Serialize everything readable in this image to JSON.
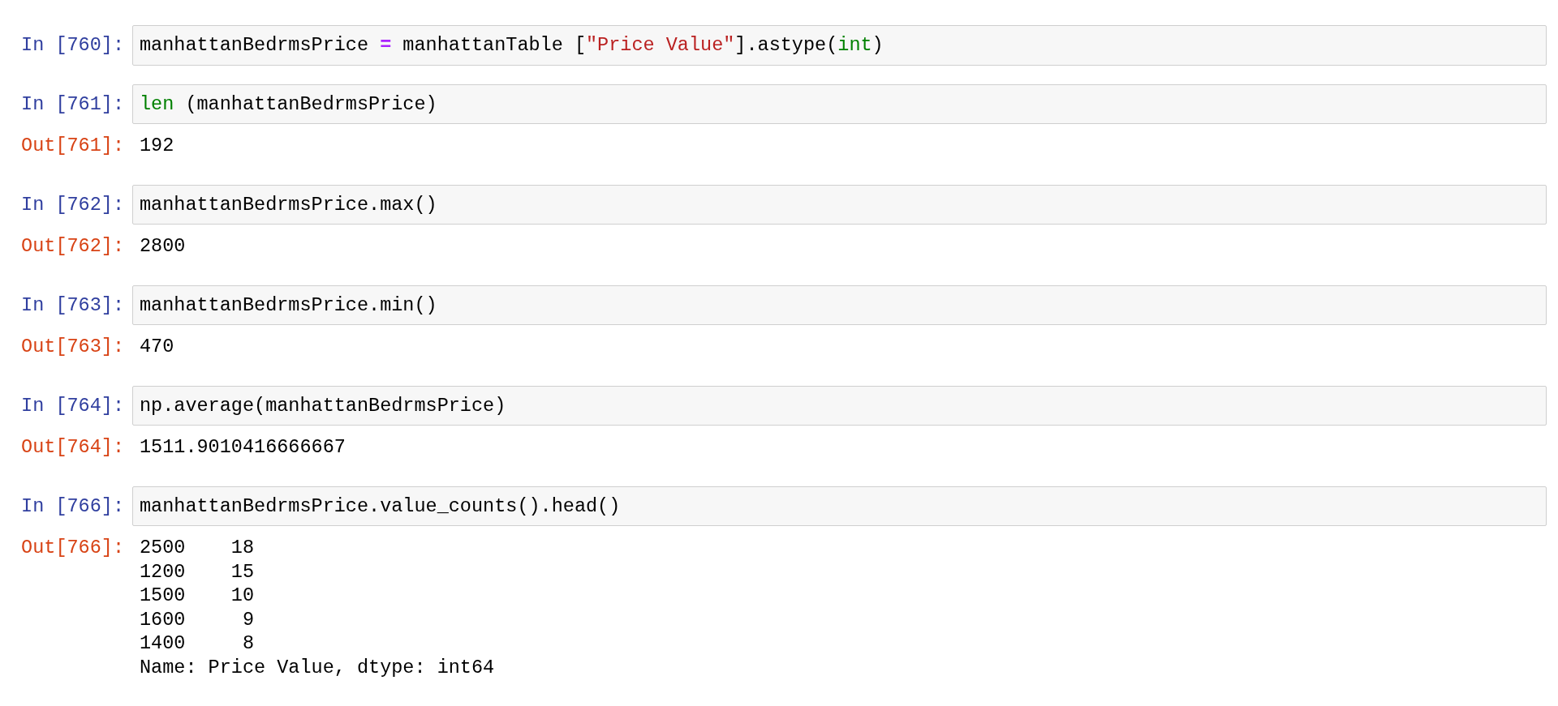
{
  "cells": [
    {
      "in_prompt": "In [760]:",
      "code": [
        {
          "kind": "plain",
          "text": "manhattanBedrmsPrice "
        },
        {
          "kind": "operator",
          "text": "="
        },
        {
          "kind": "plain",
          "text": " manhattanTable ["
        },
        {
          "kind": "string",
          "text": "\"Price Value\""
        },
        {
          "kind": "plain",
          "text": "].astype("
        },
        {
          "kind": "builtin",
          "text": "int"
        },
        {
          "kind": "plain",
          "text": ")"
        }
      ]
    },
    {
      "in_prompt": "In [761]:",
      "code": [
        {
          "kind": "builtin",
          "text": "len"
        },
        {
          "kind": "plain",
          "text": " (manhattanBedrmsPrice)"
        }
      ],
      "out_prompt": "Out[761]:",
      "output": [
        "192"
      ]
    },
    {
      "in_prompt": "In [762]:",
      "code": [
        {
          "kind": "plain",
          "text": "manhattanBedrmsPrice.max()"
        }
      ],
      "out_prompt": "Out[762]:",
      "output": [
        "2800"
      ]
    },
    {
      "in_prompt": "In [763]:",
      "code": [
        {
          "kind": "plain",
          "text": "manhattanBedrmsPrice.min()"
        }
      ],
      "out_prompt": "Out[763]:",
      "output": [
        "470"
      ]
    },
    {
      "in_prompt": "In [764]:",
      "code": [
        {
          "kind": "plain",
          "text": "np.average(manhattanBedrmsPrice)"
        }
      ],
      "out_prompt": "Out[764]:",
      "output": [
        "1511.9010416666667"
      ]
    },
    {
      "in_prompt": "In [766]:",
      "code": [
        {
          "kind": "plain",
          "text": "manhattanBedrmsPrice.value_counts().head()"
        }
      ],
      "out_prompt": "Out[766]:",
      "output": [
        "2500    18",
        "1200    15",
        "1500    10",
        "1600     9",
        "1400     8",
        "Name: Price Value, dtype: int64"
      ]
    }
  ]
}
